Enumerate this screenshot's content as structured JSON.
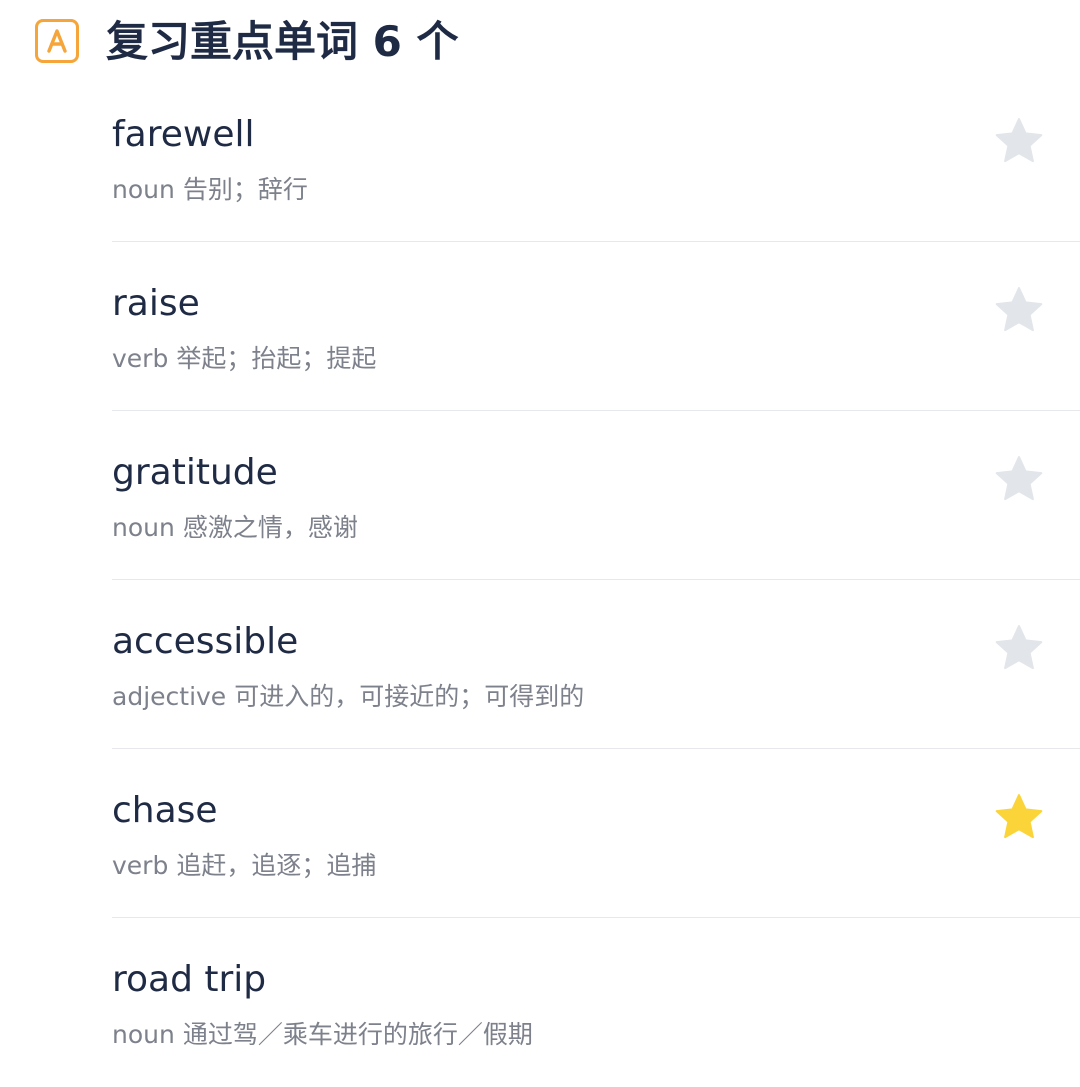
{
  "header": {
    "icon": "letter-a-icon",
    "icon_letter": "A",
    "title": "复习重点单词 6 个",
    "accent_color": "#f5a53a"
  },
  "colors": {
    "star_off": "#e2e5ea",
    "star_on": "#fbd43a"
  },
  "words": [
    {
      "term": "farewell",
      "pos": "noun",
      "definition": "告别；辞行",
      "starred": false
    },
    {
      "term": "raise",
      "pos": "verb",
      "definition": "举起；抬起；提起",
      "starred": false
    },
    {
      "term": "gratitude",
      "pos": "noun",
      "definition": "感激之情，感谢",
      "starred": false
    },
    {
      "term": "accessible",
      "pos": "adjective",
      "definition": "可进入的，可接近的；可得到的",
      "starred": false
    },
    {
      "term": "chase",
      "pos": "verb",
      "definition": "追赶，追逐；追捕",
      "starred": true
    },
    {
      "term": "road trip",
      "pos": "noun",
      "definition": "通过驾／乘车进行的旅行／假期",
      "starred": null
    }
  ]
}
